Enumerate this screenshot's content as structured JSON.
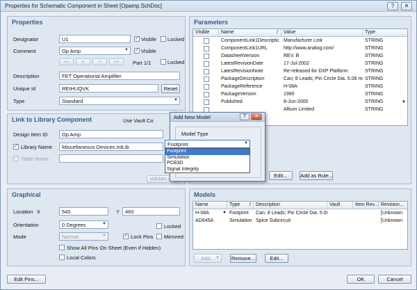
{
  "window": {
    "title": "Properties for Schematic Component in Sheet [Opamp.SchDoc]",
    "help_btn": "?",
    "close_btn": "✕"
  },
  "properties": {
    "title": "Properties",
    "designator_label": "Designator",
    "designator_value": "U1",
    "visible_label": "Visible",
    "locked_label": "Locked",
    "comment_label": "Comment",
    "comment_value": "Op Amp",
    "comment_visible_label": "Visible",
    "nav_first": "<<",
    "nav_prev": "<",
    "nav_next": ">",
    "nav_last": ">>",
    "part_label": "Part 1/1",
    "part_locked_label": "Locked",
    "description_label": "Description",
    "description_value": "FET Operational Amplifier",
    "unique_id_label": "Unique Id",
    "unique_id_value": "REIHUQVK",
    "reset_label": "Reset",
    "type_label": "Type",
    "type_value": "Standard"
  },
  "link": {
    "title": "Link to Library Component",
    "use_vault_label": "Use Vault Co",
    "design_item_label": "Design Item ID",
    "design_item_value": "Op Amp",
    "library_name_label": "Library Name",
    "library_name_value": "Miscellaneous Devices.IntLib",
    "table_name_label": "Table Name",
    "validate_label": "Validate Link"
  },
  "graphical": {
    "title": "Graphical",
    "location_label": "Location",
    "x_label": "X",
    "x_value": "540",
    "y_label": "Y",
    "y_value": "460",
    "orientation_label": "Orientation",
    "orientation_value": "0 Degrees",
    "orientation_locked_label": "Locked",
    "mode_label": "Mode",
    "mode_value": "Normal",
    "lock_pins_label": "Lock Pins",
    "mirrored_label": "Mirrored",
    "show_pins_label": "Show All Pins On Sheet (Even if Hidden)",
    "local_colors_label": "Local Colors"
  },
  "parameters": {
    "title": "Parameters",
    "columns": [
      "Visible",
      "Name",
      "Value",
      "Type"
    ],
    "sort_marker": "/",
    "rows": [
      {
        "name": "ComponentLink1Descriptic",
        "value": "Manufacturer Link",
        "type": "STRING"
      },
      {
        "name": "ComponentLink1URL",
        "value": "http://www.analog.com/",
        "type": "STRING"
      },
      {
        "name": "DatasheetVersion",
        "value": "REV. B",
        "type": "STRING"
      },
      {
        "name": "LatestRevisionDate",
        "value": "17-Jul-2002",
        "type": "STRING"
      },
      {
        "name": "LatestRevisionNote",
        "value": "Re-released for DXP Platform.",
        "type": "STRING"
      },
      {
        "name": "PackageDescription",
        "value": "Can; 8 Leads; Pin Circle Dia. 5.08 mm",
        "type": "STRING"
      },
      {
        "name": "PackageReference",
        "value": "H-08A",
        "type": "STRING"
      },
      {
        "name": "PackageVersion",
        "value": "1990",
        "type": "STRING"
      },
      {
        "name": "Published",
        "value": "8-Jun-2000",
        "type": "STRING"
      },
      {
        "name": "",
        "value": "Altium Limited",
        "type": "STRING"
      }
    ],
    "edit_label": "Edit...",
    "add_rule_label": "Add as Rule..."
  },
  "models": {
    "title": "Models",
    "columns": [
      "Name",
      "Type",
      "/",
      "Description",
      "Vault",
      "Item Rev...",
      "Revision..."
    ],
    "rows": [
      {
        "name": "H-08A",
        "type": "Footprint",
        "description": "Can; 8 Leads; Pin Circle Dia. 5.08 r",
        "vault": "",
        "item_rev": "",
        "revision": "[Unknown"
      },
      {
        "name": "AD645A",
        "type": "Simulation",
        "description": "Spice Subcircuit",
        "vault": "",
        "item_rev": "",
        "revision": "[Unknown"
      }
    ],
    "add_label": "Add...",
    "remove_label": "Remove...",
    "edit_label": "Edit..."
  },
  "dialog": {
    "title": "Add New Model",
    "help_btn": "?",
    "close_btn": "✕",
    "model_type_label": "Model Type",
    "selected": "Footprint",
    "options": [
      "Footprint",
      "Simulation",
      "PCB3D",
      "Signal Integrity"
    ]
  },
  "footer": {
    "edit_pins_label": "Edit Pins...",
    "ok_label": "OK",
    "cancel_label": "Cancel"
  }
}
